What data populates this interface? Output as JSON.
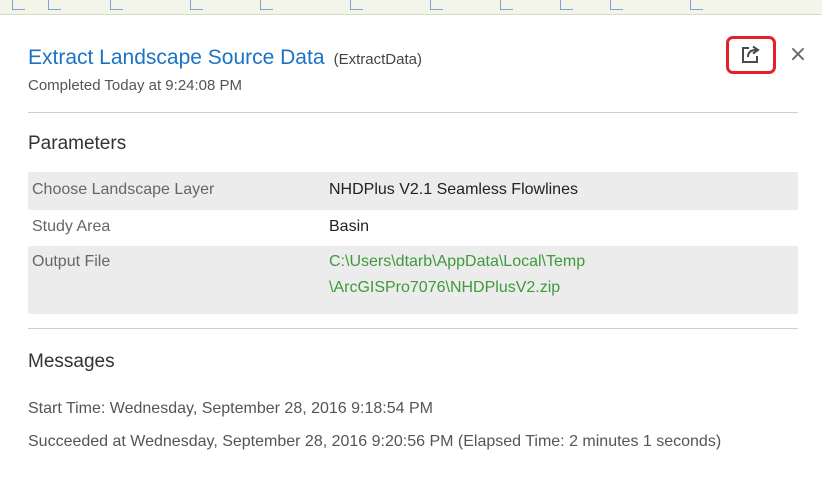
{
  "tool": {
    "title": "Extract Landscape Source Data",
    "subtitle": "(ExtractData)",
    "status": "Completed Today at 9:24:08 PM"
  },
  "actions": {
    "open_icon": "open-in-new-window-icon",
    "close_icon": "close-icon",
    "close_glyph": "×",
    "highlight_color": "#e4202a"
  },
  "parameters": {
    "heading": "Parameters",
    "rows": [
      {
        "label": "Choose Landscape Layer",
        "value_lines": [
          "NHDPlus V2.1 Seamless Flowlines"
        ]
      },
      {
        "label": "Study Area",
        "value_lines": [
          "Basin"
        ]
      },
      {
        "label": "Output File",
        "value_lines": [
          "C:\\Users\\dtarb\\AppData\\Local\\Temp",
          "\\ArcGISPro7076\\NHDPlusV2.zip"
        ]
      }
    ]
  },
  "messages": {
    "heading": "Messages",
    "items": [
      "Start Time: Wednesday, September 28, 2016 9:18:54 PM",
      "Succeeded at Wednesday, September 28, 2016 9:20:56 PM (Elapsed Time: 2 minutes 1 seconds)"
    ]
  },
  "colors": {
    "title": "#1b73c4",
    "path": "#3e9a3b",
    "row_shade": "#ececec"
  }
}
